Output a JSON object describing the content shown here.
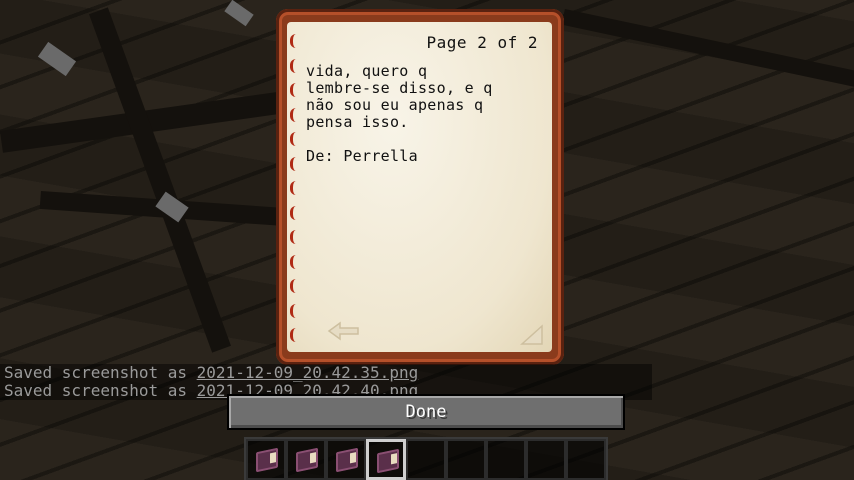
{
  "book": {
    "page_indicator": "Page 2 of 2",
    "lines": [
      "vida, quero q",
      "lembre-se disso, e q",
      "não sou eu apenas q",
      "pensa isso."
    ],
    "signature": "De: Perrella",
    "prev_page_icon": "arrow-left-icon"
  },
  "chat": {
    "lines": [
      {
        "prefix": "Saved screenshot as ",
        "file": "2021-12-09_20.42.35.png"
      },
      {
        "prefix": "Saved screenshot as ",
        "file": "2021-12-09_20.42.40.png"
      }
    ]
  },
  "done_label": "Done",
  "hotbar": {
    "slots": [
      "written-book",
      "written-book",
      "written-book",
      "written-book",
      "",
      "",
      "",
      "",
      ""
    ],
    "selected_slot": 4
  }
}
